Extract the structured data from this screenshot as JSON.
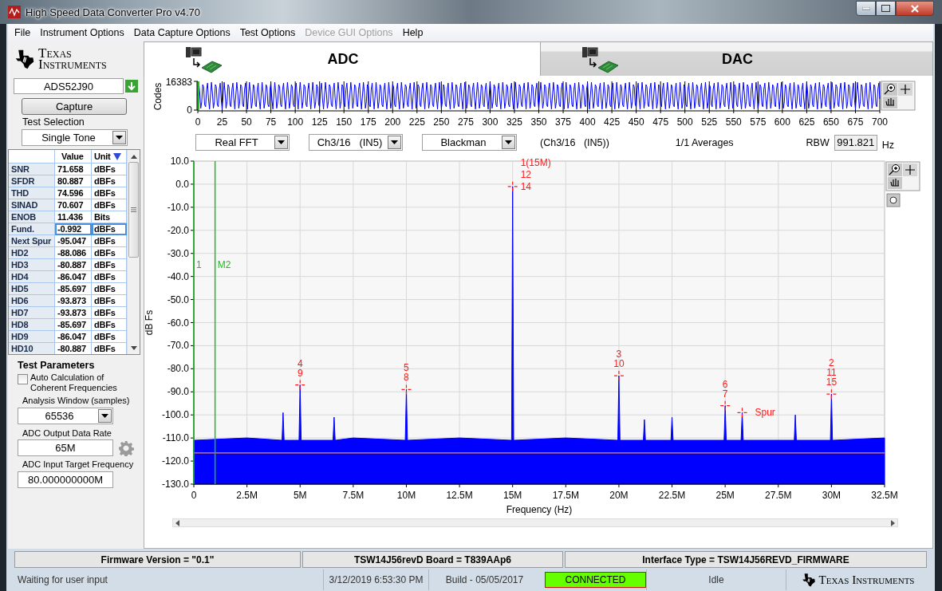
{
  "window": {
    "title": "High Speed Data Converter Pro v4.70"
  },
  "menu": [
    {
      "label": "File",
      "disabled": false
    },
    {
      "label": "Instrument Options",
      "disabled": false
    },
    {
      "label": "Data Capture Options",
      "disabled": false
    },
    {
      "label": "Test Options",
      "disabled": false
    },
    {
      "label": "Device GUI Options",
      "disabled": true
    },
    {
      "label": "Help",
      "disabled": false
    }
  ],
  "logo": {
    "text": "Texas Instruments"
  },
  "tabs": [
    {
      "label": "ADC",
      "selected": true
    },
    {
      "label": "DAC",
      "selected": false
    }
  ],
  "device": {
    "value": "ADS52J90"
  },
  "capture_button": "Capture",
  "test_selection": {
    "label": "Test Selection",
    "value": "Single Tone"
  },
  "results_table": {
    "columns": [
      "Value",
      "Unit"
    ],
    "rows": [
      {
        "name": "SNR",
        "value": "71.658",
        "unit": "dBFs",
        "selected": false
      },
      {
        "name": "SFDR",
        "value": "80.887",
        "unit": "dBFs",
        "selected": false
      },
      {
        "name": "THD",
        "value": "74.596",
        "unit": "dBFs",
        "selected": false
      },
      {
        "name": "SINAD",
        "value": "70.607",
        "unit": "dBFs",
        "selected": false
      },
      {
        "name": "ENOB",
        "value": "11.436",
        "unit": "Bits",
        "selected": false
      },
      {
        "name": "Fund.",
        "value": "-0.992",
        "unit": "dBFs",
        "selected": true
      },
      {
        "name": "Next Spur",
        "value": "-95.047",
        "unit": "dBFs",
        "selected": false
      },
      {
        "name": "HD2",
        "value": "-88.086",
        "unit": "dBFs",
        "selected": false
      },
      {
        "name": "HD3",
        "value": "-80.887",
        "unit": "dBFs",
        "selected": false
      },
      {
        "name": "HD4",
        "value": "-86.047",
        "unit": "dBFs",
        "selected": false
      },
      {
        "name": "HD5",
        "value": "-85.697",
        "unit": "dBFs",
        "selected": false
      },
      {
        "name": "HD6",
        "value": "-93.873",
        "unit": "dBFs",
        "selected": false
      },
      {
        "name": "HD7",
        "value": "-93.873",
        "unit": "dBFs",
        "selected": false
      },
      {
        "name": "HD8",
        "value": "-85.697",
        "unit": "dBFs",
        "selected": false
      },
      {
        "name": "HD9",
        "value": "-86.047",
        "unit": "dBFs",
        "selected": false
      },
      {
        "name": "HD10",
        "value": "-80.887",
        "unit": "dBFs",
        "selected": false
      }
    ]
  },
  "test_parameters": {
    "title": "Test Parameters",
    "auto_calc": {
      "label": "Auto Calculation of Coherent Frequencies",
      "checked": false
    },
    "analysis_window": {
      "label": "Analysis Window (samples)",
      "value": "65536"
    },
    "data_rate": {
      "label": "ADC Output Data Rate",
      "value": "65M"
    },
    "target_frequency": {
      "label": "ADC Input Target Frequency",
      "value": "80.000000000M"
    }
  },
  "waveform": {
    "ylabel": "Codes",
    "yticks": [
      "16383",
      "0"
    ],
    "xticks": [
      "0",
      "25",
      "50",
      "75",
      "100",
      "125",
      "150",
      "175",
      "200",
      "225",
      "250",
      "275",
      "300",
      "325",
      "350",
      "375",
      "400",
      "425",
      "450",
      "475",
      "500",
      "525",
      "550",
      "575",
      "600",
      "625",
      "650",
      "675",
      "700"
    ]
  },
  "fft_controls": {
    "mode": "Real FFT",
    "channel": "Ch3/16   (IN5)",
    "window": "Blackman",
    "channel_caption": "(Ch3/16   (IN5))",
    "averages": "1/1 Averages",
    "rbw_label": "RBW",
    "rbw": "991.821",
    "rbw_unit": "Hz"
  },
  "spectrum": {
    "chart_data": {
      "type": "area",
      "xlabel": "Frequency (Hz)",
      "ylabel": "dB Fs",
      "x": [
        0,
        0,
        2.5,
        4.15,
        4.2,
        4.25,
        4.95,
        5,
        5.05,
        6.55,
        6.6,
        6.65,
        7.5,
        9.95,
        10,
        10.05,
        12.5,
        14.95,
        15,
        15.05,
        17.5,
        19.95,
        20,
        20.05,
        21.15,
        21.2,
        21.25,
        22.45,
        22.5,
        22.55,
        24.95,
        25,
        25.05,
        25.75,
        25.8,
        25.85,
        28.25,
        28.3,
        28.35,
        29.95,
        30,
        30.05,
        32.5,
        32.5
      ],
      "series": [
        {
          "color": "#0000ff",
          "values": [
            -130,
            -111,
            -110,
            -111,
            -99,
            -111,
            -111,
            -87,
            -111,
            -111,
            -101,
            -111,
            -110,
            -111,
            -89,
            -111,
            -110,
            -111,
            -1,
            -111,
            -110,
            -111,
            -83,
            -111,
            -111,
            -102,
            -111,
            -111,
            -101,
            -111,
            -111,
            -96,
            -111,
            -111,
            -99,
            -111,
            -111,
            -100,
            -111,
            -111,
            -91,
            -111,
            -110,
            -130
          ]
        }
      ],
      "xlim": [
        0,
        32.5
      ],
      "ylim": [
        -130,
        10
      ],
      "grid": true,
      "xticks": [
        {
          "value": 0,
          "label": "0"
        },
        {
          "value": 2.5,
          "label": "2.5M"
        },
        {
          "value": 5,
          "label": "5M"
        },
        {
          "value": 7.5,
          "label": "7.5M"
        },
        {
          "value": 10,
          "label": "10M"
        },
        {
          "value": 12.5,
          "label": "12.5M"
        },
        {
          "value": 15,
          "label": "15M"
        },
        {
          "value": 17.5,
          "label": "17.5M"
        },
        {
          "value": 20,
          "label": "20M"
        },
        {
          "value": 22.5,
          "label": "22.5M"
        },
        {
          "value": 25,
          "label": "25M"
        },
        {
          "value": 27.5,
          "label": "27.5M"
        },
        {
          "value": 30,
          "label": "30M"
        },
        {
          "value": 32.5,
          "label": "32.5M"
        }
      ],
      "yticks": [
        {
          "value": 10,
          "label": "10.0"
        },
        {
          "value": 0,
          "label": "0.0"
        },
        {
          "value": -10,
          "label": "-10.0"
        },
        {
          "value": -20,
          "label": "-20.0"
        },
        {
          "value": -30,
          "label": "-30.0"
        },
        {
          "value": -40,
          "label": "-40.0"
        },
        {
          "value": -50,
          "label": "-50.0"
        },
        {
          "value": -60,
          "label": "-60.0"
        },
        {
          "value": -70,
          "label": "-70.0"
        },
        {
          "value": -80,
          "label": "-80.0"
        },
        {
          "value": -90,
          "label": "-90.0"
        },
        {
          "value": -100,
          "label": "-100.0"
        },
        {
          "value": -110,
          "label": "-110.0"
        },
        {
          "value": -120,
          "label": "-120.0"
        },
        {
          "value": -130,
          "label": "-130.0"
        }
      ],
      "ref_lines": [
        {
          "axis": "y",
          "value": -116.5,
          "color": "#ff8c3c"
        },
        {
          "axis": "x",
          "value": 0,
          "color": "#22bb22"
        },
        {
          "axis": "x",
          "value": 1,
          "color": "#22bb22"
        }
      ],
      "annotations": [
        {
          "text": "1(15M)",
          "x": 15,
          "y": -1
        },
        {
          "text": "12",
          "x": 15,
          "y": -1
        },
        {
          "text": "14",
          "x": 15,
          "y": -1
        },
        {
          "text": "4",
          "x": 5,
          "y": -87
        },
        {
          "text": "9",
          "x": 5,
          "y": -87
        },
        {
          "text": "5",
          "x": 10,
          "y": -89
        },
        {
          "text": "8",
          "x": 10,
          "y": -89
        },
        {
          "text": "3",
          "x": 20,
          "y": -83
        },
        {
          "text": "10",
          "x": 20,
          "y": -83
        },
        {
          "text": "6",
          "x": 25,
          "y": -96
        },
        {
          "text": "7",
          "x": 25,
          "y": -96
        },
        {
          "text": "2",
          "x": 30,
          "y": -91
        },
        {
          "text": "11",
          "x": 30,
          "y": -91
        },
        {
          "text": "15",
          "x": 30,
          "y": -91
        },
        {
          "text": "Spur",
          "x": 25.8,
          "y": -99
        }
      ]
    },
    "cursor_labels": [
      "1",
      "M2"
    ]
  },
  "status": {
    "firmware": "Firmware Version = \"0.1\"",
    "board": "TSW14J56revD Board = T839AAp6",
    "interface": "Interface Type = TSW14J56REVD_FIRMWARE",
    "message": "Waiting for user input",
    "datetime": "3/12/2019 6:53:30 PM",
    "build": "Build  - 05/05/2017",
    "connection": "CONNECTED",
    "connected": true,
    "state": "Idle",
    "logo": "Texas Instruments"
  }
}
